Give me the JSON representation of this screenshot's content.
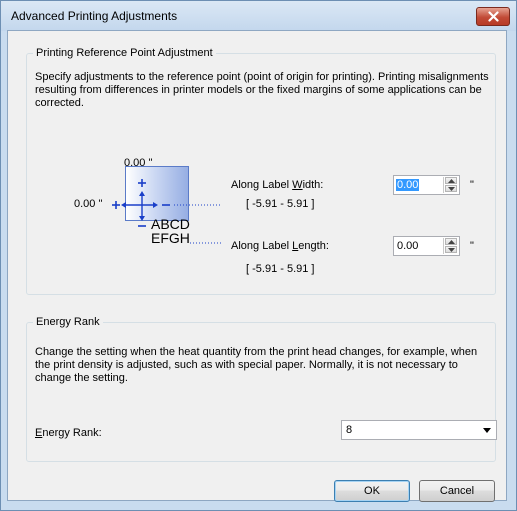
{
  "window": {
    "title": "Advanced Printing Adjustments",
    "close_icon": "close-icon",
    "accent_color": "#c24b37"
  },
  "reference_group": {
    "title": "Printing Reference Point Adjustment",
    "description": "Specify adjustments to the reference point (point of origin for printing). Printing misalignments resulting from differences in printer models or the fixed margins of some applications can be corrected.",
    "diagram": {
      "top_value": "0.00 \"",
      "left_value": "0.00 \"",
      "label_line1": "ABCD",
      "label_line2": "EFGH"
    },
    "width": {
      "label_before": "Along Label ",
      "label_access": "W",
      "label_after": "idth:",
      "value": "0.00",
      "unit": "\"",
      "range": "[ -5.91 - 5.91 ]"
    },
    "length": {
      "label_before": "Along Label ",
      "label_access": "L",
      "label_after": "ength:",
      "value": "0.00",
      "unit": "\"",
      "range": "[ -5.91 - 5.91 ]"
    }
  },
  "energy_group": {
    "title": "Energy Rank",
    "description": "Change the setting when the heat quantity from the print head changes, for example, when the print density is adjusted, such as with special paper. Normally, it is not necessary to change the setting.",
    "label_access": "E",
    "label_rest": "nergy Rank:",
    "selected": "8"
  },
  "buttons": {
    "ok": "OK",
    "cancel": "Cancel"
  }
}
